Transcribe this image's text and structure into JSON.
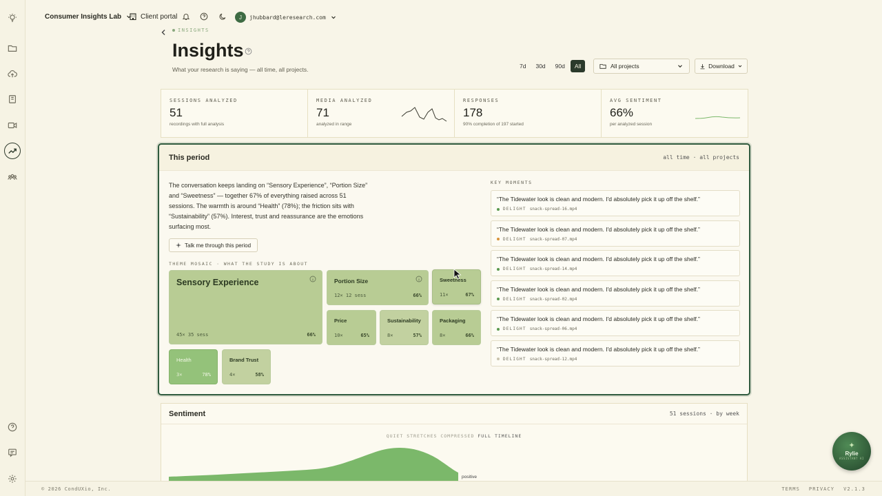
{
  "topbar": {
    "org": "Consumer Insights Lab",
    "portal": "Client portal",
    "avatar_initial": "J",
    "email": "jhubbard@leresearch.com"
  },
  "page": {
    "breadcrumb": "INSIGHTS",
    "title": "Insights",
    "subtitle": "What your research is saying — all time, all projects."
  },
  "filters": {
    "ranges": [
      "7d",
      "30d",
      "90d",
      "All"
    ],
    "active_range": "All",
    "project_select": "All projects",
    "download": "Download"
  },
  "stats": [
    {
      "label": "SESSIONS ANALYZED",
      "value": "51",
      "note": "recordings with full analysis"
    },
    {
      "label": "MEDIA ANALYZED",
      "value": "71",
      "note": "analyzed in range"
    },
    {
      "label": "RESPONSES",
      "value": "178",
      "note": "90% completion of 197 started"
    },
    {
      "label": "AVG SENTIMENT",
      "value": "66%",
      "note": "per analyzed session"
    }
  ],
  "period": {
    "title": "This period",
    "scope": "all time · all projects",
    "summary": "The conversation keeps landing on “Sensory Experience”, “Portion Size” and “Sweetness” — together 67% of everything raised across 51 sessions. The warmth is around “Health” (78%); the friction sits with “Sustainability” (57%). Interest, trust and reassurance are the emotions surfacing most.",
    "talk_button": "Talk me through this period",
    "mosaic_label": "THEME MOSAIC · WHAT THE STUDY IS ABOUT",
    "themes": [
      {
        "name": "Sensory Experience",
        "meta": "45× 35 sess",
        "pct": "66%"
      },
      {
        "name": "Portion Size",
        "meta": "12× 12 sess",
        "pct": "66%"
      },
      {
        "name": "Sweetness",
        "meta": "11×",
        "pct": "67%"
      },
      {
        "name": "Price",
        "meta": "10×",
        "pct": "65%"
      },
      {
        "name": "Sustainability",
        "meta": "8×",
        "pct": "57%"
      },
      {
        "name": "Packaging",
        "meta": "8×",
        "pct": "66%"
      },
      {
        "name": "Health",
        "meta": "3×",
        "pct": "78%"
      },
      {
        "name": "Brand Trust",
        "meta": "4×",
        "pct": "58%"
      }
    ],
    "key_moments_label": "KEY MOMENTS",
    "key_moments": [
      {
        "quote": "“The Tidewater look is clean and modern. I'd absolutely pick it up off the shelf.”",
        "tag": "DELIGHT",
        "file": "snack-spread-16.mp4",
        "dot": "#5a9a4e"
      },
      {
        "quote": "“The Tidewater look is clean and modern. I'd absolutely pick it up off the shelf.”",
        "tag": "DELIGHT",
        "file": "snack-spread-07.mp4",
        "dot": "#d9933a"
      },
      {
        "quote": "“The Tidewater look is clean and modern. I'd absolutely pick it up off the shelf.”",
        "tag": "DELIGHT",
        "file": "snack-spread-14.mp4",
        "dot": "#5a9a4e"
      },
      {
        "quote": "“The Tidewater look is clean and modern. I'd absolutely pick it up off the shelf.”",
        "tag": "DELIGHT",
        "file": "snack-spread-02.mp4",
        "dot": "#5a9a4e"
      },
      {
        "quote": "“The Tidewater look is clean and modern. I'd absolutely pick it up off the shelf.”",
        "tag": "DELIGHT",
        "file": "snack-spread-06.mp4",
        "dot": "#5a9a4e"
      },
      {
        "quote": "“The Tidewater look is clean and modern. I'd absolutely pick it up off the shelf.”",
        "tag": "DELIGHT",
        "file": "snack-spread-12.mp4",
        "dot": "#c9c4ae"
      }
    ]
  },
  "sentiment": {
    "title": "Sentiment",
    "meta": "51 sessions · by week",
    "quiet": "QUIET STRETCHES COMPRESSED",
    "full": "FULL TIMELINE",
    "positive_label": "positive"
  },
  "footer": {
    "copyright": "© 2026 CondUXio, Inc.",
    "terms": "TERMS",
    "privacy": "PRIVACY",
    "version": "V2.1.3"
  },
  "assistant": {
    "name": "Rylie",
    "sub": "ASSISTANT AI"
  },
  "colors": {
    "accent": "#2f5a3d",
    "tile": "#b5ca93",
    "tile_warm": "#8fbf74",
    "chart": "#7bb86a"
  }
}
